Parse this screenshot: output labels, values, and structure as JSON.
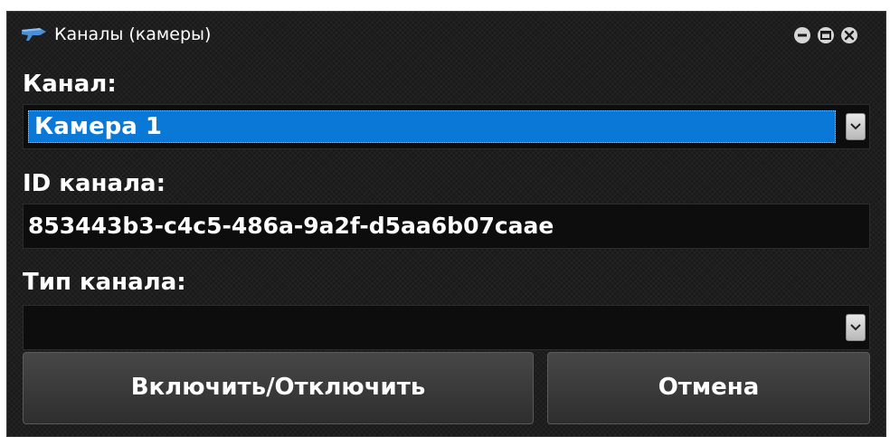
{
  "window": {
    "title": "Каналы (камеры)",
    "icon": "camera-icon"
  },
  "channel": {
    "label": "Канал:",
    "selected": "Камера 1"
  },
  "channel_id": {
    "label": "ID канала:",
    "value": "853443b3-c4c5-486a-9a2f-d5aa6b07caae"
  },
  "channel_type": {
    "label": "Тип канала:",
    "selected": ""
  },
  "buttons": {
    "toggle_label": "Включить/Отключить",
    "cancel_label": "Отмена"
  },
  "colors": {
    "selection": "#0a78d7",
    "background": "#1a1a1a",
    "text": "#ffffff"
  }
}
